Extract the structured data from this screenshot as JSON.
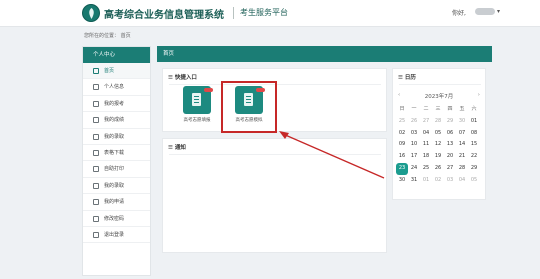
{
  "header": {
    "title": "高考综合业务信息管理系统",
    "subtitle": "考生服务平台",
    "greeting": "你好,"
  },
  "breadcrumb": "您所在的位置：  首页",
  "sidebar": {
    "title": "个人中心",
    "items": [
      {
        "label": "首页",
        "active": true
      },
      {
        "label": "个人信息"
      },
      {
        "label": "我的报考"
      },
      {
        "label": "我的成绩"
      },
      {
        "label": "我的录取"
      },
      {
        "label": "表格下载"
      },
      {
        "label": "自助打印"
      },
      {
        "label": "我的录取"
      },
      {
        "label": "我的申请"
      },
      {
        "label": "修改密码"
      },
      {
        "label": "退出登录"
      }
    ]
  },
  "main": {
    "tab": "首页",
    "quick": {
      "title": "快捷入口",
      "tiles": [
        {
          "label": "高考志愿填报",
          "icon": "form-edit-icon"
        },
        {
          "label": "高考志愿模拟",
          "icon": "form-edit-icon",
          "highlighted": true
        }
      ]
    },
    "notice": {
      "title": "通知"
    }
  },
  "calendar": {
    "title": "日历",
    "month_label": "2023年7月",
    "prev": "‹",
    "next": "›",
    "weekdays": [
      "日",
      "一",
      "二",
      "三",
      "四",
      "五",
      "六"
    ],
    "days": [
      "25",
      "26",
      "27",
      "28",
      "29",
      "30",
      "01",
      "02",
      "03",
      "04",
      "05",
      "06",
      "07",
      "08",
      "09",
      "10",
      "11",
      "12",
      "13",
      "14",
      "15",
      "16",
      "17",
      "18",
      "19",
      "20",
      "21",
      "22",
      "23",
      "24",
      "25",
      "26",
      "27",
      "28",
      "29",
      "30",
      "31",
      "01",
      "02",
      "03",
      "04",
      "05"
    ],
    "today": "23"
  },
  "colors": {
    "brand": "#1b7d75",
    "highlight": "#c62828",
    "today": "#1b9c8f"
  }
}
